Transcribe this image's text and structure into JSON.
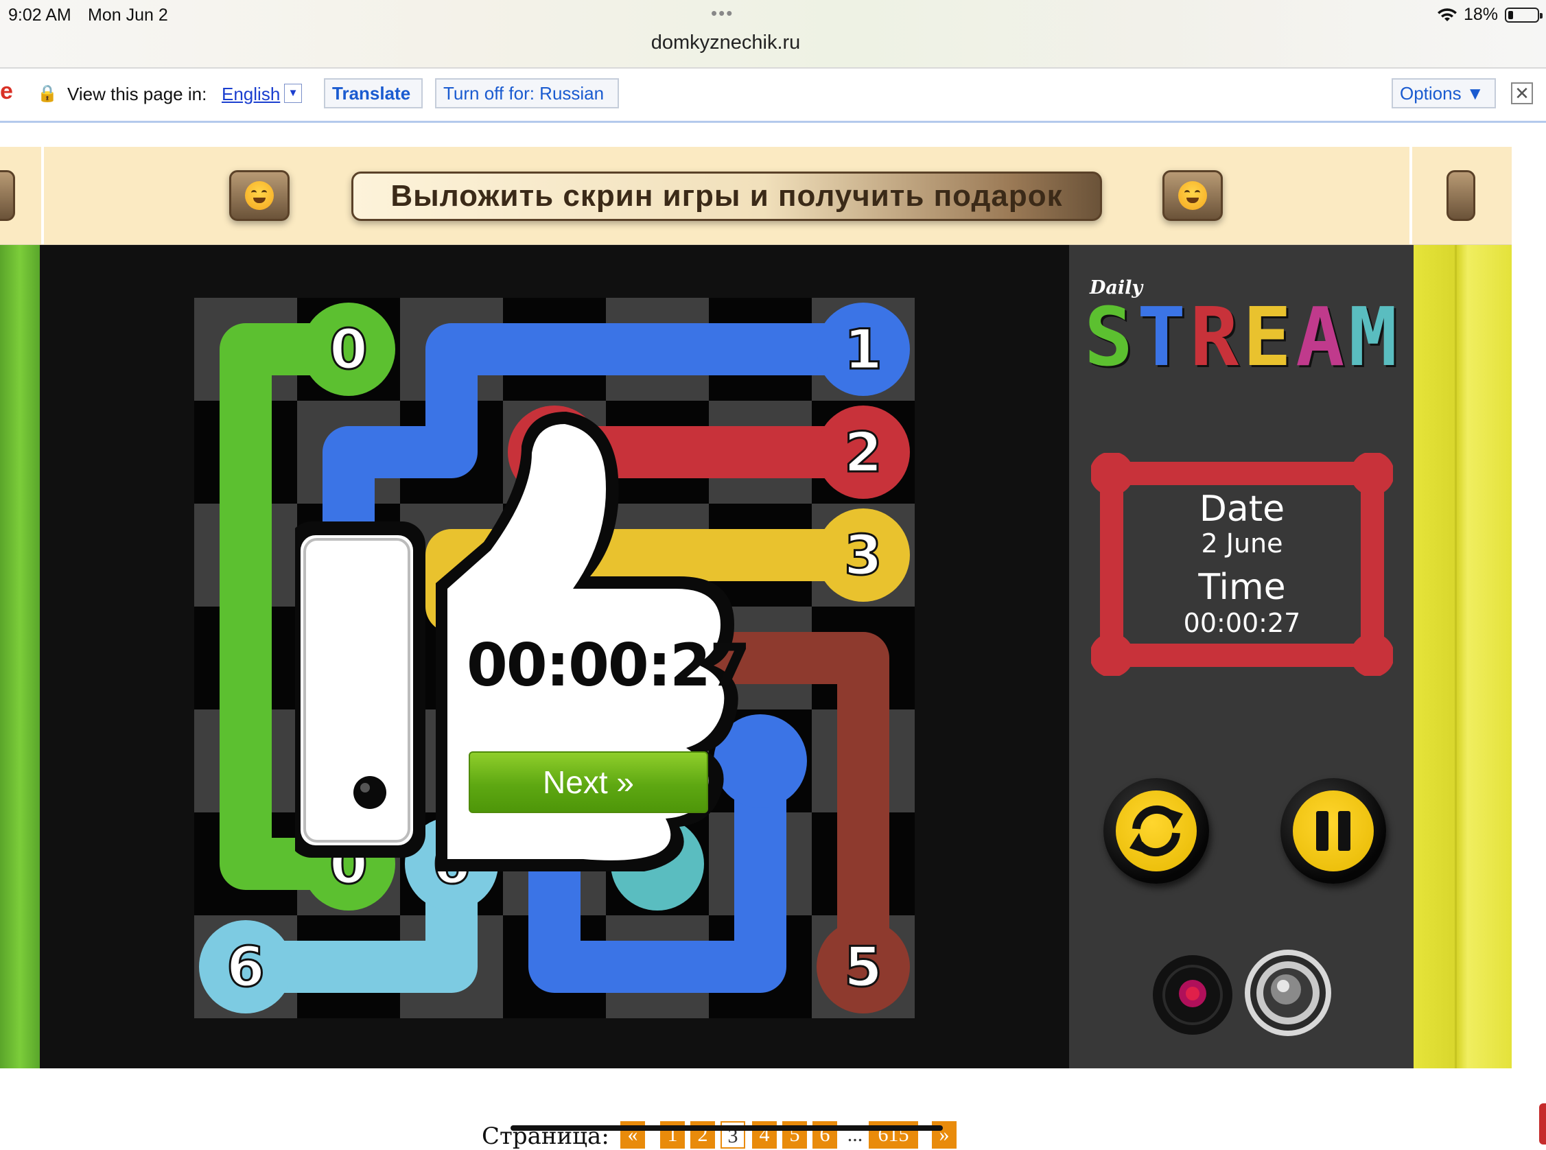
{
  "status_bar": {
    "time": "9:02 AM",
    "date": "Mon Jun 2",
    "url": "domkyznechik.ru",
    "battery": "18%"
  },
  "translate_bar": {
    "prompt": "View this page in:",
    "language": "English",
    "translate_label": "Translate",
    "turn_off_label": "Turn off for: Russian",
    "options_label": "Options ▼"
  },
  "banner": {
    "cta": "Выложить скрин игры и получить подарок"
  },
  "game": {
    "timer": "00:00:27",
    "next_label": "Next »",
    "colors": {
      "green": "#5cc030",
      "blue": "#3b74e6",
      "red": "#c8323a",
      "yellow": "#e9c22e",
      "brown": "#8e3a2e",
      "lightblue": "#7dcbe2",
      "teal": "#5abdc0"
    },
    "endpoints": [
      {
        "label": "0",
        "col": 1,
        "row": 0,
        "color": "green"
      },
      {
        "label": "1",
        "col": 6,
        "row": 0,
        "color": "blue"
      },
      {
        "label": "2",
        "col": 6,
        "row": 1,
        "color": "red"
      },
      {
        "label": "2",
        "col": 3,
        "row": 1,
        "color": "red"
      },
      {
        "label": "3",
        "col": 6,
        "row": 2,
        "color": "yellow"
      },
      {
        "label": "0",
        "col": 1,
        "row": 5,
        "color": "green"
      },
      {
        "label": "6",
        "col": 2,
        "row": 5,
        "color": "lightblue"
      },
      {
        "label": "6",
        "col": 0,
        "row": 6,
        "color": "lightblue"
      },
      {
        "label": "5",
        "col": 6,
        "row": 6,
        "color": "brown"
      }
    ]
  },
  "panel": {
    "logo_small": "Daily",
    "logo_letters": [
      "S",
      "T",
      "R",
      "E",
      "A",
      "M"
    ],
    "logo_colors": [
      "#5cc030",
      "#3b74e6",
      "#c8323a",
      "#e9c22e",
      "#c03a8c",
      "#5abdc0"
    ],
    "date_label": "Date",
    "date_value": "2 June",
    "time_label": "Time",
    "time_value": "00:00:27"
  },
  "pager": {
    "label": "Страница:",
    "prev": "«",
    "pages": [
      "1",
      "2",
      "3",
      "4",
      "5",
      "6"
    ],
    "current": "3",
    "ellipsis": "...",
    "last": "615",
    "next": "»"
  }
}
